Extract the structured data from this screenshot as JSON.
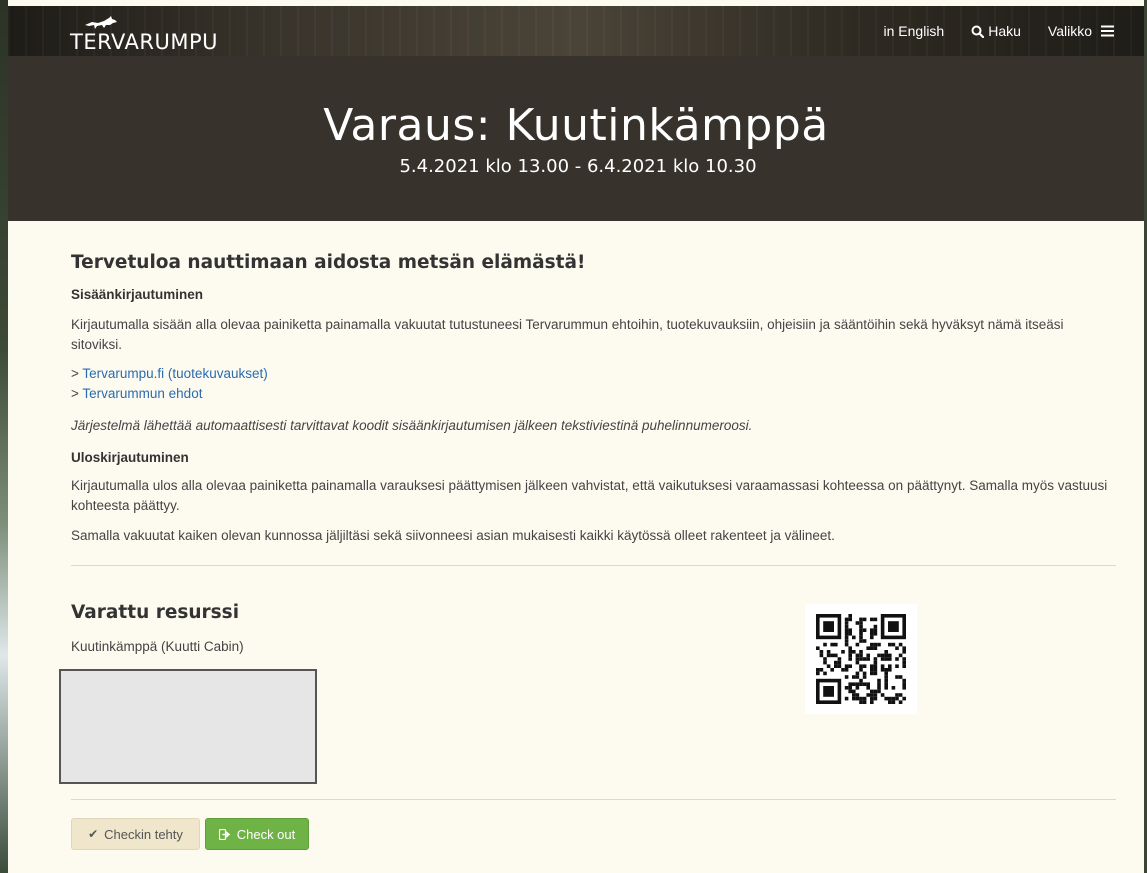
{
  "header": {
    "logo_text": "TERVARUMPU",
    "nav": {
      "english": "in English",
      "search": "Haku",
      "menu": "Valikko"
    },
    "icons": {
      "search": "search-icon",
      "menu": "hamburger-menu-icon"
    }
  },
  "hero": {
    "title": "Varaus: Kuutinkämppä",
    "subtitle": "5.4.2021 klo 13.00 - 6.4.2021 klo 10.30"
  },
  "main": {
    "welcome": "Tervetuloa nauttimaan aidosta metsän elämästä!",
    "login": {
      "heading": "Sisäänkirjautuminen",
      "text": "Kirjautumalla sisään alla olevaa painiketta painamalla vakuutat tutustuneesi Tervarummun ehtoihin, tuotekuvauksiin, ohjeisiin ja sääntöihin sekä hyväksyt nämä itseäsi sitoviksi.",
      "link1_prefix": "> ",
      "link1": "Tervarumpu.fi (tuotekuvaukset)",
      "link2_prefix": "> ",
      "link2": "Tervarummun ehdot",
      "note": "Järjestelmä lähettää automaattisesti tarvittavat koodit sisäänkirjautumisen jälkeen tekstiviestinä puhelinnumeroosi."
    },
    "logout": {
      "heading": "Uloskirjautuminen",
      "text1": "Kirjautumalla ulos alla olevaa painiketta painamalla varauksesi päättymisen jälkeen vahvistat, että vaikutuksesi varaamassasi kohteessa on päättynyt. Samalla myös vastuusi kohteesta päättyy.",
      "text2": "Samalla vakuutat kaiken olevan kunnossa jäljiltäsi sekä siivonneesi asian mukaisesti kaikki käytössä olleet rakenteet ja välineet."
    },
    "resource": {
      "title": "Varattu resurssi",
      "name": "Kuutinkämppä (Kuutti Cabin)"
    },
    "buttons": {
      "checkin": "Checkin tehty",
      "checkout": "Check out"
    },
    "icons": {
      "checkin": "check-icon",
      "checkout": "sign-out-icon",
      "qr": "qr-code"
    }
  },
  "colors": {
    "page_bg": "#fdfbf0",
    "hero_bg": "#37332c",
    "link": "#2a6cb0",
    "checkout_green": "#6fb347",
    "checkin_beige": "#f0e6cc"
  }
}
